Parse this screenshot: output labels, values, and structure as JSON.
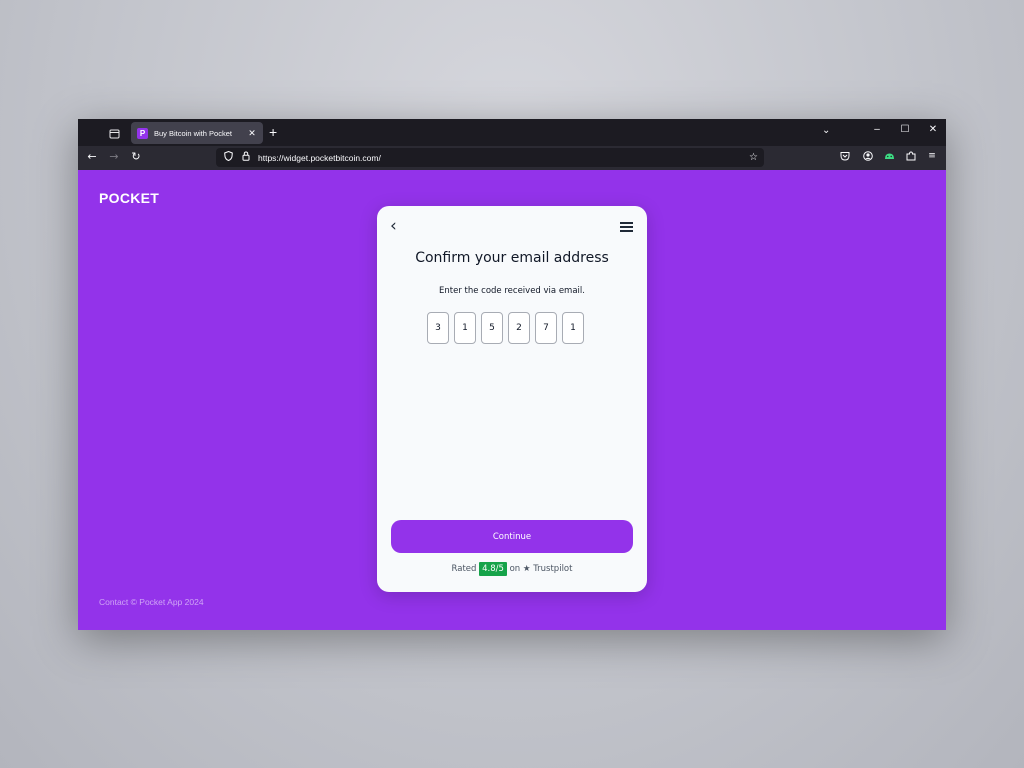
{
  "browser": {
    "tab": {
      "favicon": "P",
      "title": "Buy Bitcoin with Pocket",
      "close": "✕"
    },
    "new_tab": "+",
    "url": "https://widget.pocketbitcoin.com/",
    "icons": {
      "tab_list": "calendar-icon",
      "back": "arrow-left-icon",
      "forward": "arrow-right-icon",
      "reload": "reload-icon",
      "shield": "shield-icon",
      "lock": "lock-icon",
      "bookmark": "star-icon",
      "pocket": "pocket-icon",
      "account": "account-icon",
      "extension_android": "android-icon",
      "extensions": "puzzle-icon",
      "menu": "hamburger-icon"
    }
  },
  "page": {
    "logo": "POCKET",
    "footer": "Contact © Pocket App 2024",
    "brand_color": "#9333ea"
  },
  "card": {
    "title": "Confirm your email address",
    "subtitle": "Enter the code received via email.",
    "code": [
      "3",
      "1",
      "5",
      "2",
      "7",
      "1"
    ],
    "continue_label": "Continue",
    "rating": {
      "prefix": "Rated",
      "score": "4.8/5",
      "suffix": "on ★ Trustpilot",
      "badge_color": "#16a34a"
    }
  }
}
